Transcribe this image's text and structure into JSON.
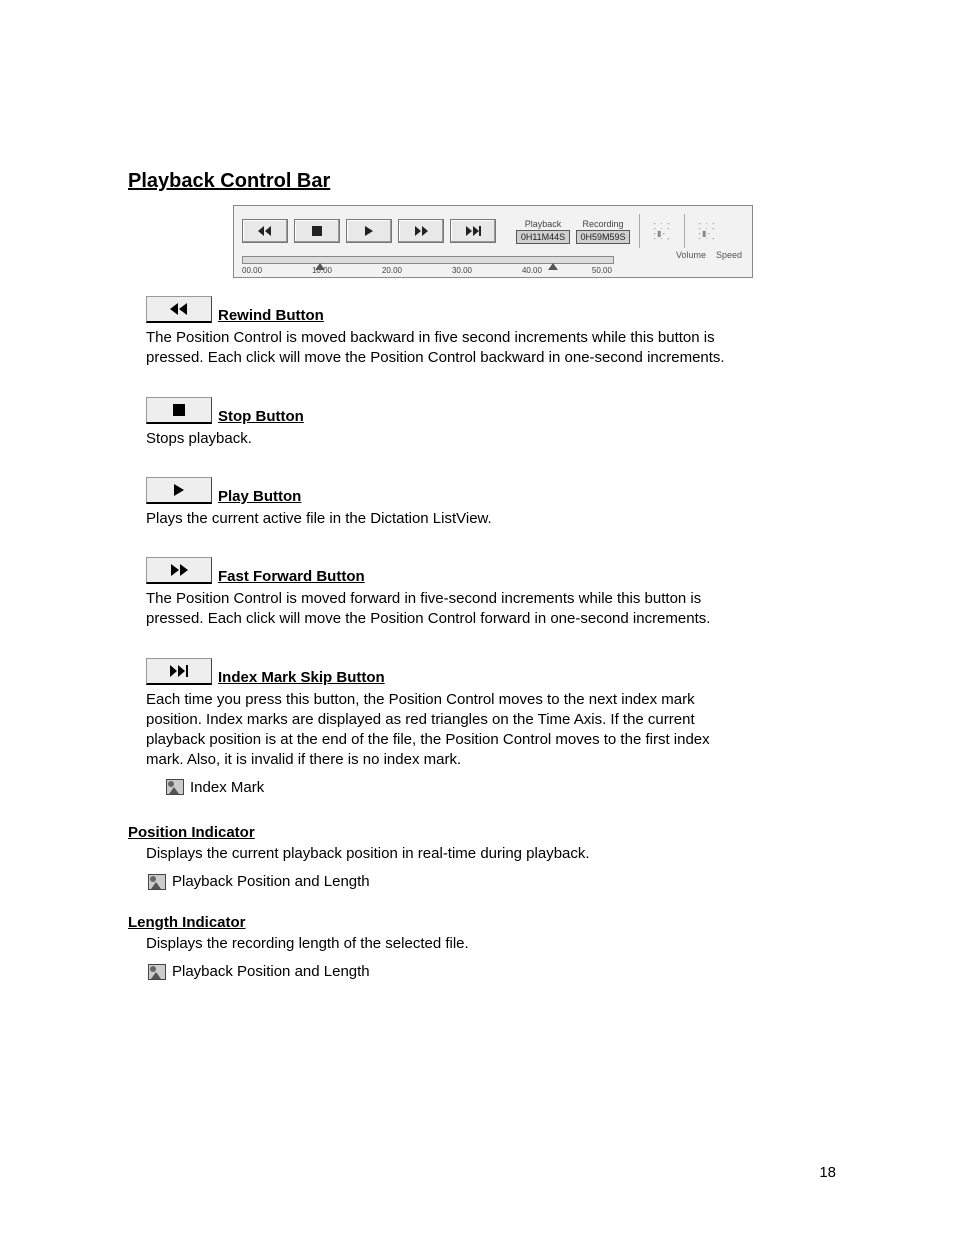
{
  "title": "Playback Control Bar",
  "toolbar": {
    "playback_label": "Playback",
    "recording_label": "Recording",
    "playback_value": "0H11M44S",
    "recording_value": "0H59M59S",
    "ticks": [
      "00.00",
      "10.00",
      "20.00",
      "30.00",
      "40.00",
      "50.00"
    ],
    "volume_label": "Volume",
    "speed_label": "Speed"
  },
  "sections": {
    "rewind": {
      "title": "Rewind Button",
      "body": "The Position Control is moved backward in five second increments while this button is pressed.  Each click will move the Position Control backward in one-second increments."
    },
    "stop": {
      "title": "Stop Button",
      "body": "Stops playback."
    },
    "play": {
      "title": "Play Button",
      "body": "Plays the current active file in the Dictation ListView."
    },
    "ff": {
      "title": "Fast Forward Button",
      "body": "The Position Control is moved forward in five-second increments while this button is pressed.  Each click will move the Position Control forward in one-second increments."
    },
    "skip": {
      "title": "Index Mark Skip Button",
      "body": "Each time you press this button, the Position Control moves to the next index mark position.  Index marks are displayed as red triangles on the Time Axis.  If the current playback position is at the end of the file, the Position Control moves to the first index mark.  Also, it is invalid if there is no index mark.",
      "sub": "Index Mark"
    },
    "position": {
      "title": "Position Indicator",
      "body": "Displays the current playback position in real-time during playback.",
      "sub": "Playback Position and Length"
    },
    "length": {
      "title": "Length Indicator",
      "body": "Displays the recording length of the selected file.",
      "sub": "Playback Position and Length"
    }
  },
  "page_number": "18"
}
